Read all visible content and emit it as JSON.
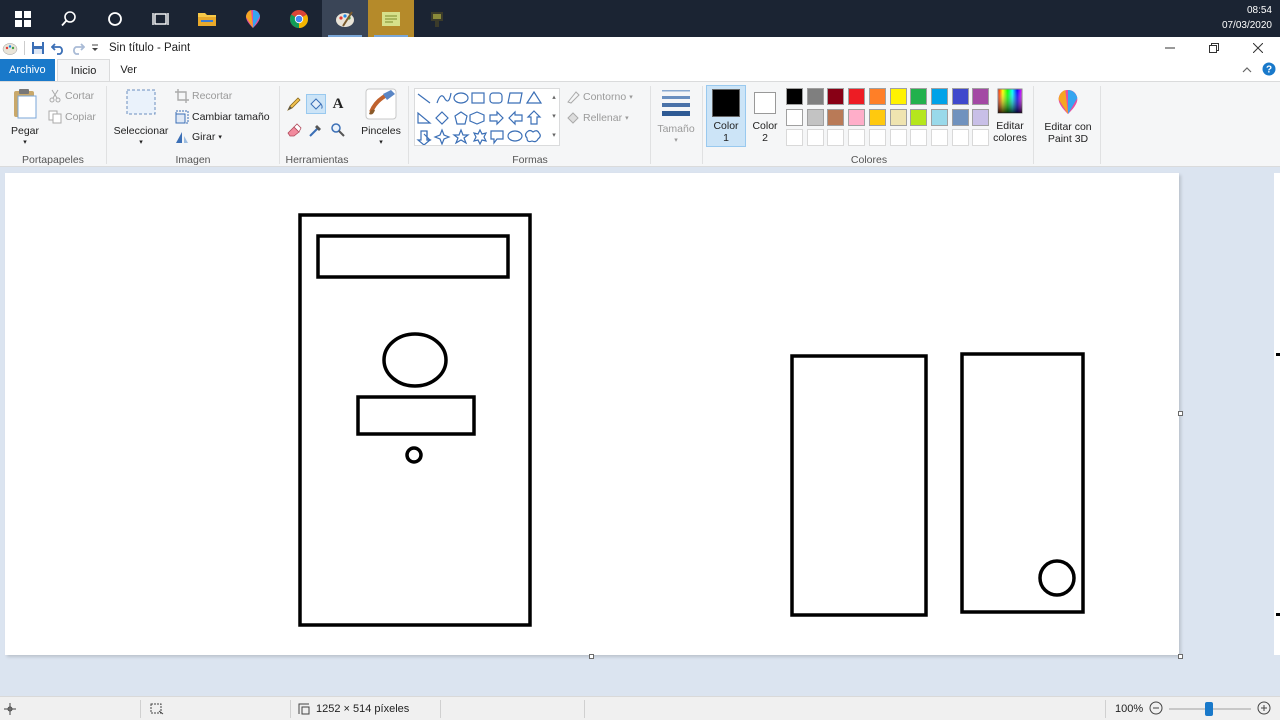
{
  "taskbar": {
    "apps": [
      "start-icon",
      "search-icon",
      "cortana-icon",
      "task-view-icon",
      "file-explorer-icon",
      "paint-3d-icon",
      "chrome-icon",
      "paint-icon",
      "notes-icon",
      "app-icon"
    ],
    "time": "08:54",
    "date": "07/03/2020"
  },
  "window": {
    "title": "Sin título - Paint"
  },
  "tabs": {
    "file": "Archivo",
    "home": "Inicio",
    "view": "Ver"
  },
  "clipboard": {
    "paste": "Pegar",
    "cut": "Cortar",
    "copy": "Copiar",
    "label": "Portapapeles"
  },
  "image": {
    "select": "Seleccionar",
    "crop": "Recortar",
    "resize": "Cambiar tamaño",
    "rotate": "Girar",
    "label": "Imagen"
  },
  "tools": {
    "label": "Herramientas",
    "text_glyph": "A"
  },
  "brushes": {
    "label": "Pinceles"
  },
  "shapes": {
    "outline": "Contorno",
    "fill": "Rellenar",
    "label": "Formas"
  },
  "size": {
    "label": "Tamaño"
  },
  "colors": {
    "color1": "Color",
    "color1_num": "1",
    "color2": "Color",
    "color2_num": "2",
    "edit": "Editar colores",
    "label": "Colores",
    "palette": [
      "#000000",
      "#7f7f7f",
      "#880015",
      "#ed1c24",
      "#ff7f27",
      "#fff200",
      "#22b14c",
      "#00a2e8",
      "#3f48cc",
      "#a349a4",
      "#ffffff",
      "#c3c3c3",
      "#b97a57",
      "#ffaec9",
      "#ffc90e",
      "#efe4b0",
      "#b5e61d",
      "#99d9ea",
      "#7092be",
      "#c8bfe7"
    ]
  },
  "paint3d": {
    "label": "Editar con Paint 3D"
  },
  "status": {
    "dimensions": "1252 × 514 píxeles",
    "zoom": "100%"
  }
}
